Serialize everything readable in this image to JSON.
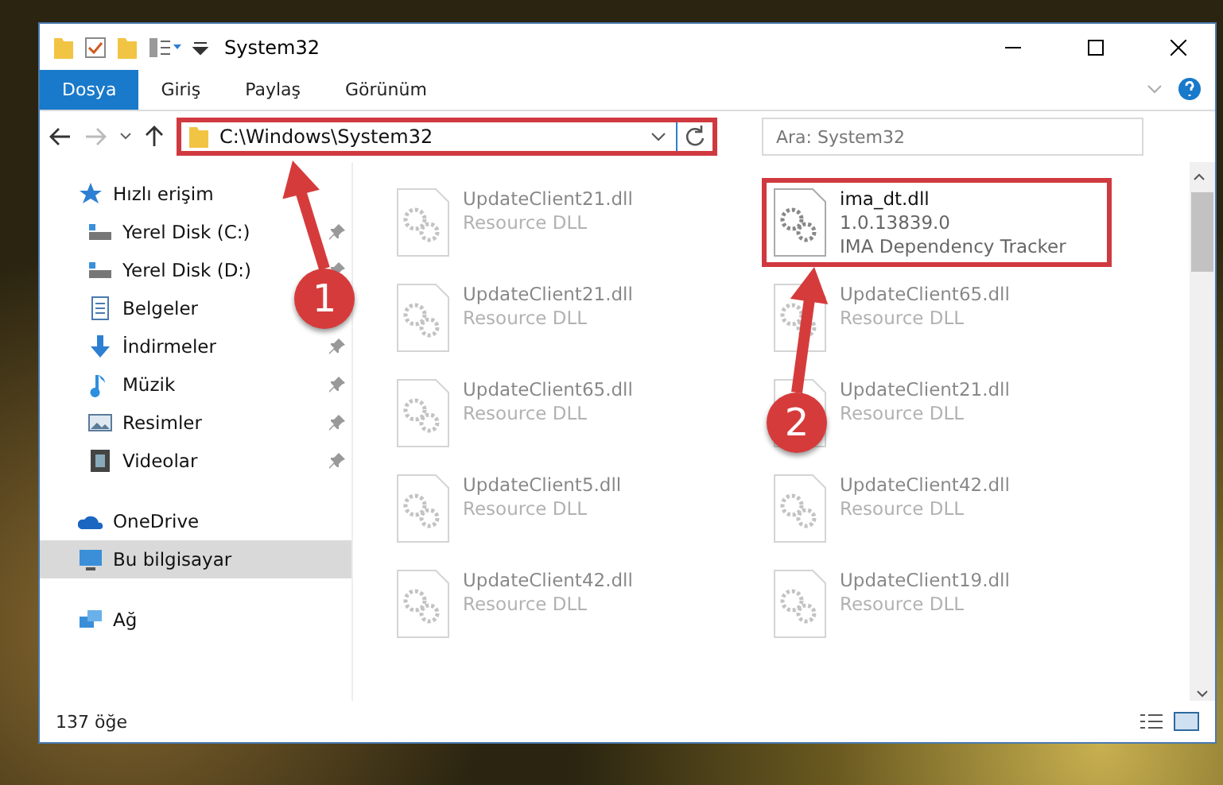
{
  "window": {
    "title": "System32"
  },
  "ribbon_tabs": [
    {
      "label": "Dosya",
      "selected": true
    },
    {
      "label": "Giriş",
      "selected": false
    },
    {
      "label": "Paylaş",
      "selected": false
    },
    {
      "label": "Görünüm",
      "selected": false
    }
  ],
  "address_bar": {
    "path": "C:\\Windows\\System32",
    "highlighted": true
  },
  "search": {
    "placeholder": "Ara: System32"
  },
  "sidebar": {
    "items": [
      {
        "label": "Hızlı erişim",
        "pinned": false,
        "selected": false,
        "children": [
          {
            "label": "Yerel Disk (C:)",
            "pinned": true,
            "selected": false
          },
          {
            "label": "Yerel Disk (D:)",
            "pinned": true,
            "selected": false
          },
          {
            "label": "Belgeler",
            "pinned": false,
            "selected": false
          },
          {
            "label": "İndirmeler",
            "pinned": true,
            "selected": false
          },
          {
            "label": "Müzik",
            "pinned": true,
            "selected": false
          },
          {
            "label": "Resimler",
            "pinned": true,
            "selected": false
          },
          {
            "label": "Videolar",
            "pinned": true,
            "selected": false
          }
        ]
      },
      {
        "label": "OneDrive",
        "pinned": false,
        "selected": false
      },
      {
        "label": "Bu bilgisayar",
        "pinned": false,
        "selected": true
      },
      {
        "label": "Ağ",
        "pinned": false,
        "selected": false
      }
    ]
  },
  "files": [
    {
      "name": "UpdateClient21.dll",
      "lines": [
        "Resource DLL"
      ],
      "faded": true,
      "highlighted": false
    },
    {
      "name": "ima_dt.dll",
      "lines": [
        "1.0.13839.0",
        "IMA Dependency Tracker"
      ],
      "faded": false,
      "highlighted": true
    },
    {
      "name": "UpdateClient21.dll",
      "lines": [
        "Resource DLL"
      ],
      "faded": true,
      "highlighted": false
    },
    {
      "name": "UpdateClient65.dll",
      "lines": [
        "Resource DLL"
      ],
      "faded": true,
      "highlighted": false
    },
    {
      "name": "UpdateClient65.dll",
      "lines": [
        "Resource DLL"
      ],
      "faded": true,
      "highlighted": false
    },
    {
      "name": "UpdateClient21.dll",
      "lines": [
        "Resource DLL"
      ],
      "faded": true,
      "highlighted": false
    },
    {
      "name": "UpdateClient5.dll",
      "lines": [
        "Resource DLL"
      ],
      "faded": true,
      "highlighted": false
    },
    {
      "name": "UpdateClient42.dll",
      "lines": [
        "Resource DLL"
      ],
      "faded": true,
      "highlighted": false
    },
    {
      "name": "UpdateClient42.dll",
      "lines": [
        "Resource DLL"
      ],
      "faded": true,
      "highlighted": false
    },
    {
      "name": "UpdateClient19.dll",
      "lines": [
        "Resource DLL"
      ],
      "faded": true,
      "highlighted": false
    }
  ],
  "status_bar": {
    "count": "137 öğe"
  },
  "annotations": [
    {
      "label": "1"
    },
    {
      "label": "2"
    }
  ]
}
